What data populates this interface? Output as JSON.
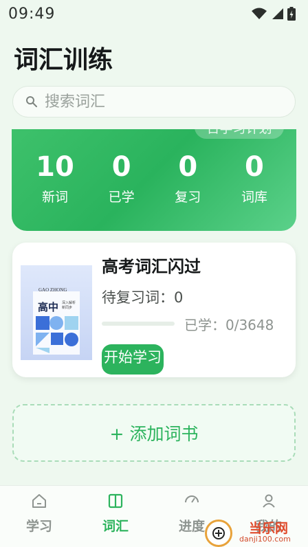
{
  "status_bar": {
    "time": "09:49"
  },
  "header": {
    "title": "词汇训练"
  },
  "search": {
    "placeholder": "搜索词汇"
  },
  "stats": {
    "plan_label": "日学习计划",
    "items": [
      {
        "value": "10",
        "label": "新词"
      },
      {
        "value": "0",
        "label": "已学"
      },
      {
        "value": "0",
        "label": "复习"
      },
      {
        "value": "0",
        "label": "词库"
      }
    ]
  },
  "book": {
    "title": "高考词汇闪过",
    "review_label": "待复习词：0",
    "learned_label": "已学：0/3648",
    "progress": 0,
    "start_label": "开始学习",
    "cover": {
      "top": "GAO ZHONG",
      "main": "高中",
      "sub": "深入解析 新同步"
    }
  },
  "add_book": {
    "label": "+ 添加词书"
  },
  "nav": {
    "items": [
      {
        "label": "学习",
        "icon": "home-icon",
        "active": false
      },
      {
        "label": "词汇",
        "icon": "book-icon",
        "active": true
      },
      {
        "label": "进度",
        "icon": "gauge-icon",
        "active": false
      },
      {
        "label": "我的",
        "icon": "user-icon",
        "active": false
      }
    ]
  },
  "watermark": {
    "text": "当乐网",
    "url": "danji100.com"
  },
  "colors": {
    "accent": "#2cb35d",
    "background": "#eef8ef",
    "inactive": "#8e9490"
  }
}
